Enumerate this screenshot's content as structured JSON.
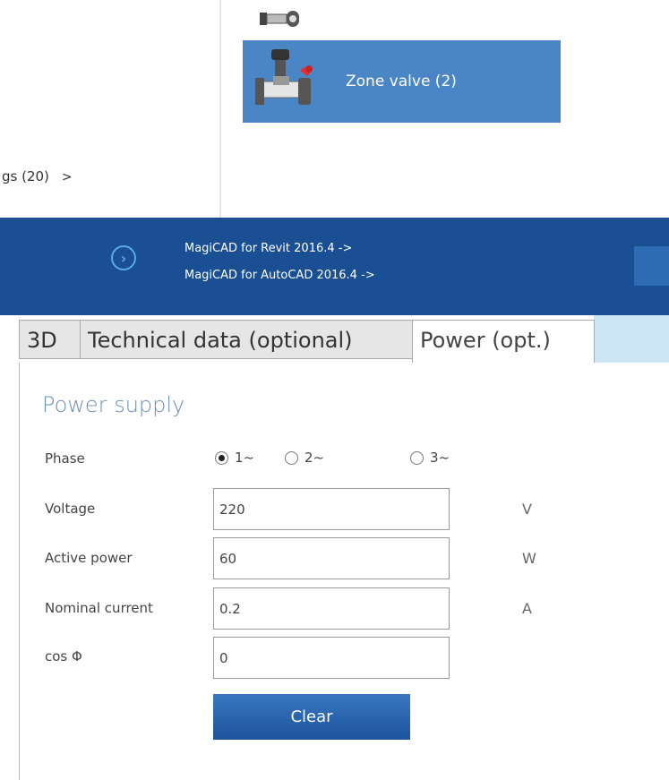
{
  "browse": {
    "zone_valve_label": "Zone valve (2)",
    "category_link": "gs (20)",
    "category_arrow": ">"
  },
  "promo": {
    "arrow_icon": "chevron-right-circle-icon",
    "link_revit": "MagiCAD for Revit 2016.4 ->",
    "link_autocad": "MagiCAD for AutoCAD 2016.4 ->"
  },
  "tabs": [
    {
      "label": "3D",
      "active": false
    },
    {
      "label": "Technical data (optional)",
      "active": false
    },
    {
      "label": "Power (opt.)",
      "active": true
    }
  ],
  "form": {
    "title": "Power supply",
    "phase": {
      "label": "Phase",
      "options": [
        "1~",
        "2~",
        "3~"
      ],
      "selected": "1~"
    },
    "voltage": {
      "label": "Voltage",
      "value": "220",
      "unit": "V"
    },
    "active_power": {
      "label": "Active power",
      "value": "60",
      "unit": "W"
    },
    "nominal_current": {
      "label": "Nominal current",
      "value": "0.2",
      "unit": "A"
    },
    "cos_phi": {
      "label": "cos Φ",
      "value": "0"
    },
    "clear_label": "Clear"
  },
  "colors": {
    "tile_blue": "#4a86c5",
    "promo_blue": "#1a4f93",
    "button_blue": "#1b539c",
    "title_blue": "#6d8eb7"
  }
}
